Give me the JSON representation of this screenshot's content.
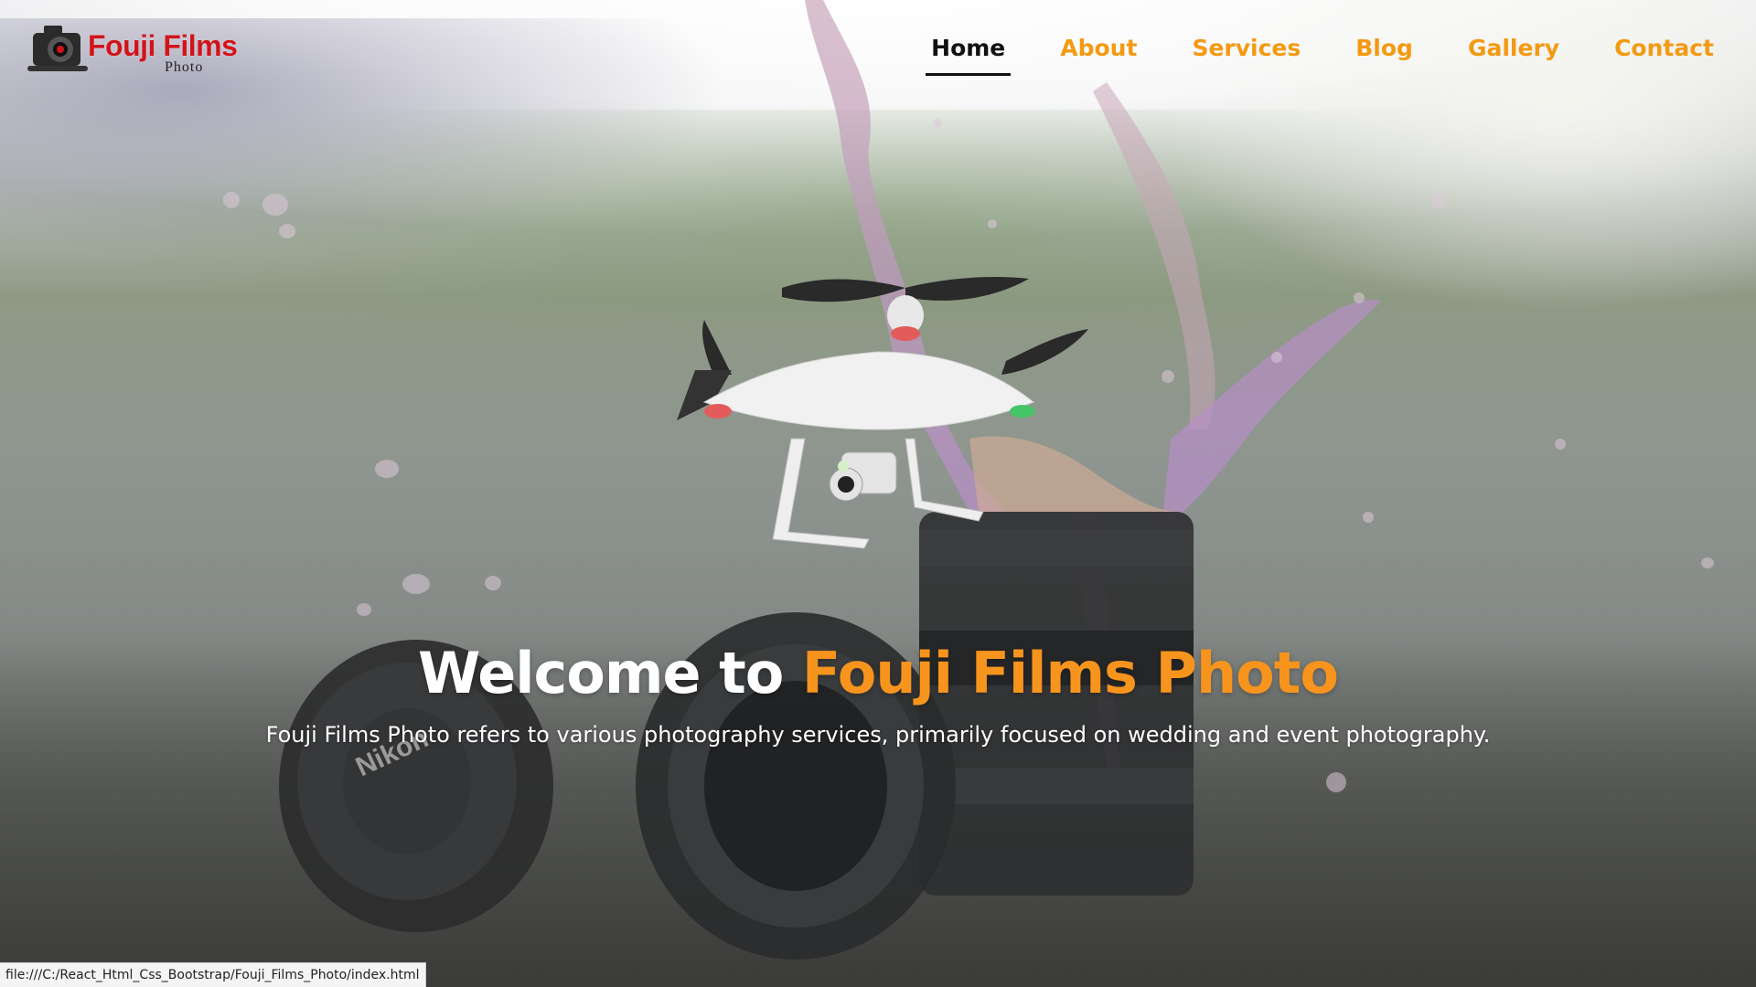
{
  "logo": {
    "title": "Fouji Films",
    "subtitle": "Photo"
  },
  "nav": {
    "items": [
      {
        "label": "Home",
        "active": true
      },
      {
        "label": "About",
        "active": false
      },
      {
        "label": "Services",
        "active": false
      },
      {
        "label": "Blog",
        "active": false
      },
      {
        "label": "Gallery",
        "active": false
      },
      {
        "label": "Contact",
        "active": false
      }
    ]
  },
  "hero": {
    "title_prefix": "Welcome to",
    "title_accent": "Fouji Films Photo",
    "subtitle": "Fouji Films Photo refers to various photography services, primarily focused on wedding and event photography."
  },
  "status_bar": {
    "url": "file:///C:/React_Html_Css_Bootstrap/Fouji_Films_Photo/index.html"
  },
  "colors": {
    "accent": "#f7941d",
    "nav_active": "#111111",
    "logo_red": "#d0141a"
  }
}
